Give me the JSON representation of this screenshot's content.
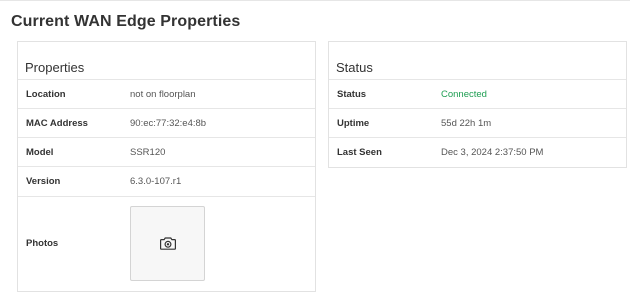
{
  "page": {
    "title": "Current WAN Edge Properties"
  },
  "properties": {
    "header": "Properties",
    "rows": [
      {
        "label": "Location",
        "value": "not on floorplan"
      },
      {
        "label": "MAC Address",
        "value": "90:ec:77:32:e4:8b"
      },
      {
        "label": "Model",
        "value": "SSR120"
      },
      {
        "label": "Version",
        "value": "6.3.0-107.r1"
      }
    ],
    "photos_label": "Photos",
    "photo_icon": "camera-icon"
  },
  "status": {
    "header": "Status",
    "rows": [
      {
        "label": "Status",
        "value": "Connected"
      },
      {
        "label": "Uptime",
        "value": "55d 22h 1m"
      },
      {
        "label": "Last Seen",
        "value": "Dec 3, 2024 2:37:50 PM"
      }
    ],
    "connected_color": "#1e9e52"
  }
}
